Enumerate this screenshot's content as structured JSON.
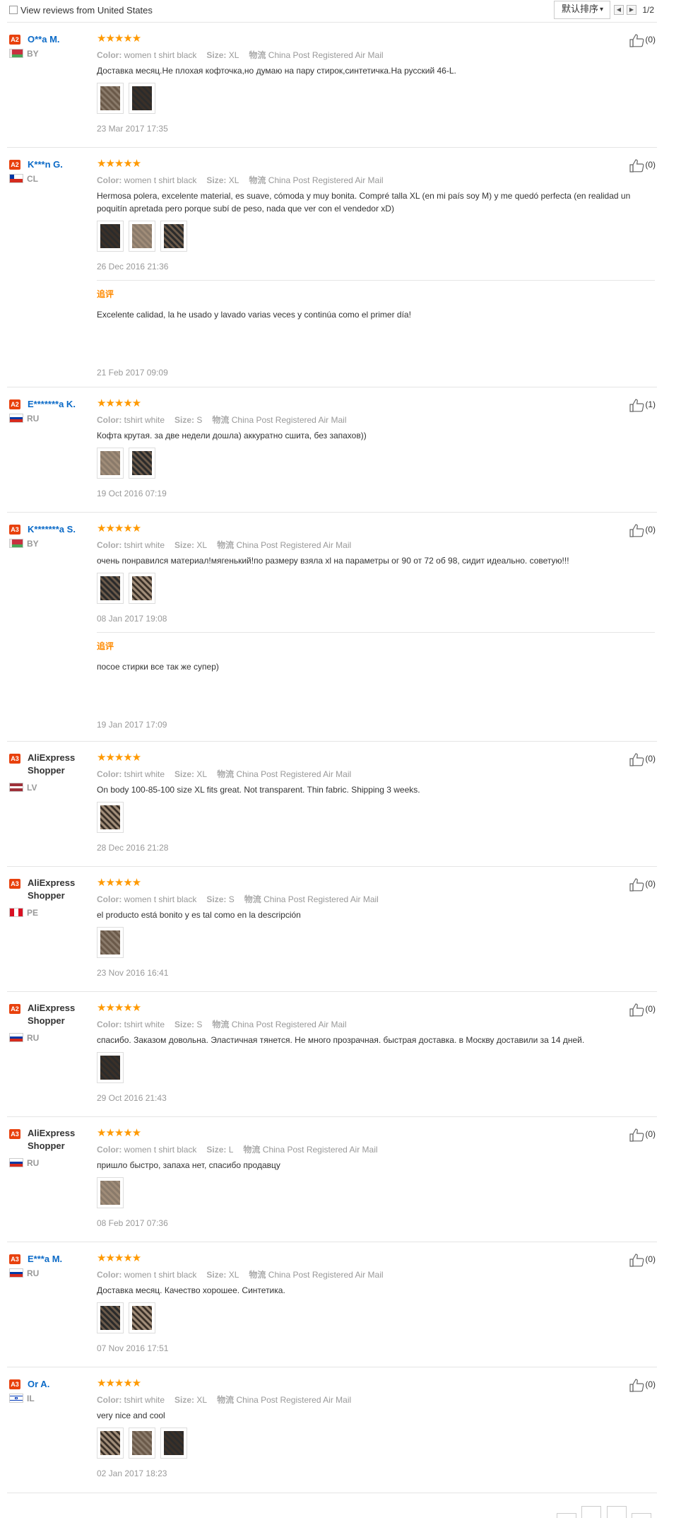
{
  "toolbar": {
    "filter_label": "View reviews from United States",
    "sort_label": "默认排序",
    "page_indicator": "1/2"
  },
  "labels": {
    "color": "Color:",
    "size": "Size:",
    "shipping": "物流",
    "followup": "追评"
  },
  "reviews": [
    {
      "level": "A2",
      "name": "O**a M.",
      "country": "BY",
      "color": "women t shirt black",
      "size": "XL",
      "shipping": "China Post Registered Air Mail",
      "text": "Доставка месяц.Не плохая кофточка,но думаю на пару стирок,синтетичка.На русский 46-L.",
      "date": "23 Mar 2017 17:35",
      "likes": "(0)",
      "photos": 2
    },
    {
      "level": "A2",
      "name": "K***n G.",
      "country": "CL",
      "color": "women t shirt black",
      "size": "XL",
      "shipping": "China Post Registered Air Mail",
      "text": "Hermosa polera, excelente material, es suave, cómoda y muy bonita. Compré talla XL (en mi país soy M) y me quedó perfecta (en realidad un poquitín apretada pero porque subí de peso, nada que ver con el vendedor xD)",
      "date": "26 Dec 2016 21:36",
      "likes": "(0)",
      "photos": 3,
      "followup": {
        "text": "Excelente calidad, la he usado y lavado varias veces y continúa como el primer día!",
        "date": "21 Feb 2017 09:09"
      }
    },
    {
      "level": "A2",
      "name": "E*******a K.",
      "country": "RU",
      "color": "tshirt white",
      "size": "S",
      "shipping": "China Post Registered Air Mail",
      "text": "Кофта крутая. за две недели дошла) аккуратно сшита, без запахов))",
      "date": "19 Oct 2016 07:19",
      "likes": "(1)",
      "photos": 2
    },
    {
      "level": "A3",
      "name": "K*******a S.",
      "country": "BY",
      "color": "tshirt white",
      "size": "XL",
      "shipping": "China Post Registered Air Mail",
      "text": "очень понравился материал!мягенький!по размеру взяла xl на параметры ог 90 от 72 об 98, сидит идеально. советую!!!",
      "date": "08 Jan 2017 19:08",
      "likes": "(0)",
      "photos": 2,
      "followup": {
        "text": "посое стирки все так же супер)",
        "date": "19 Jan 2017 17:09"
      }
    },
    {
      "level": "A3",
      "name": "AliExpress Shopper",
      "country": "LV",
      "color": "tshirt white",
      "size": "XL",
      "shipping": "China Post Registered Air Mail",
      "text": "On body 100-85-100 size XL fits great. Not transparent. Thin fabric. Shipping 3 weeks.",
      "date": "28 Dec 2016 21:28",
      "likes": "(0)",
      "photos": 1
    },
    {
      "level": "A3",
      "name": "AliExpress Shopper",
      "country": "PE",
      "color": "women t shirt black",
      "size": "S",
      "shipping": "China Post Registered Air Mail",
      "text": "el producto está bonito y es tal como en la descripción",
      "date": "23 Nov 2016 16:41",
      "likes": "(0)",
      "photos": 1
    },
    {
      "level": "A2",
      "name": "AliExpress Shopper",
      "country": "RU",
      "color": "tshirt white",
      "size": "S",
      "shipping": "China Post Registered Air Mail",
      "text": "спасибо. Заказом довольна. Эластичная тянется. Не много прозрачная. быстрая доставка. в Москву доставили за 14 дней.",
      "date": "29 Oct 2016 21:43",
      "likes": "(0)",
      "photos": 1
    },
    {
      "level": "A3",
      "name": "AliExpress Shopper",
      "country": "RU",
      "color": "women t shirt black",
      "size": "L",
      "shipping": "China Post Registered Air Mail",
      "text": "пришло быстро, запаха нет, спасибо продавцу",
      "date": "08 Feb 2017 07:36",
      "likes": "(0)",
      "photos": 1
    },
    {
      "level": "A3",
      "name": "E***a M.",
      "country": "RU",
      "color": "women t shirt black",
      "size": "XL",
      "shipping": "China Post Registered Air Mail",
      "text": "Доставка месяц. Качество хорошее. Синтетика.",
      "date": "07 Nov 2016 17:51",
      "likes": "(0)",
      "photos": 2
    },
    {
      "level": "A3",
      "name": "Or A.",
      "country": "IL",
      "color": "tshirt white",
      "size": "XL",
      "shipping": "China Post Registered Air Mail",
      "text": "very nice and cool",
      "date": "02 Jan 2017 18:23",
      "likes": "(0)",
      "photos": 3
    }
  ],
  "colors": {
    "link": "#0b6ac7",
    "star": "#ff9900",
    "level_badge": "#e8410d",
    "followup": "#ff8a00"
  },
  "icons": [
    "checkbox-icon",
    "chevron-down-icon",
    "prev-page-icon",
    "next-page-icon",
    "thumbs-up-icon",
    "star-icon",
    "flag-icon"
  ]
}
